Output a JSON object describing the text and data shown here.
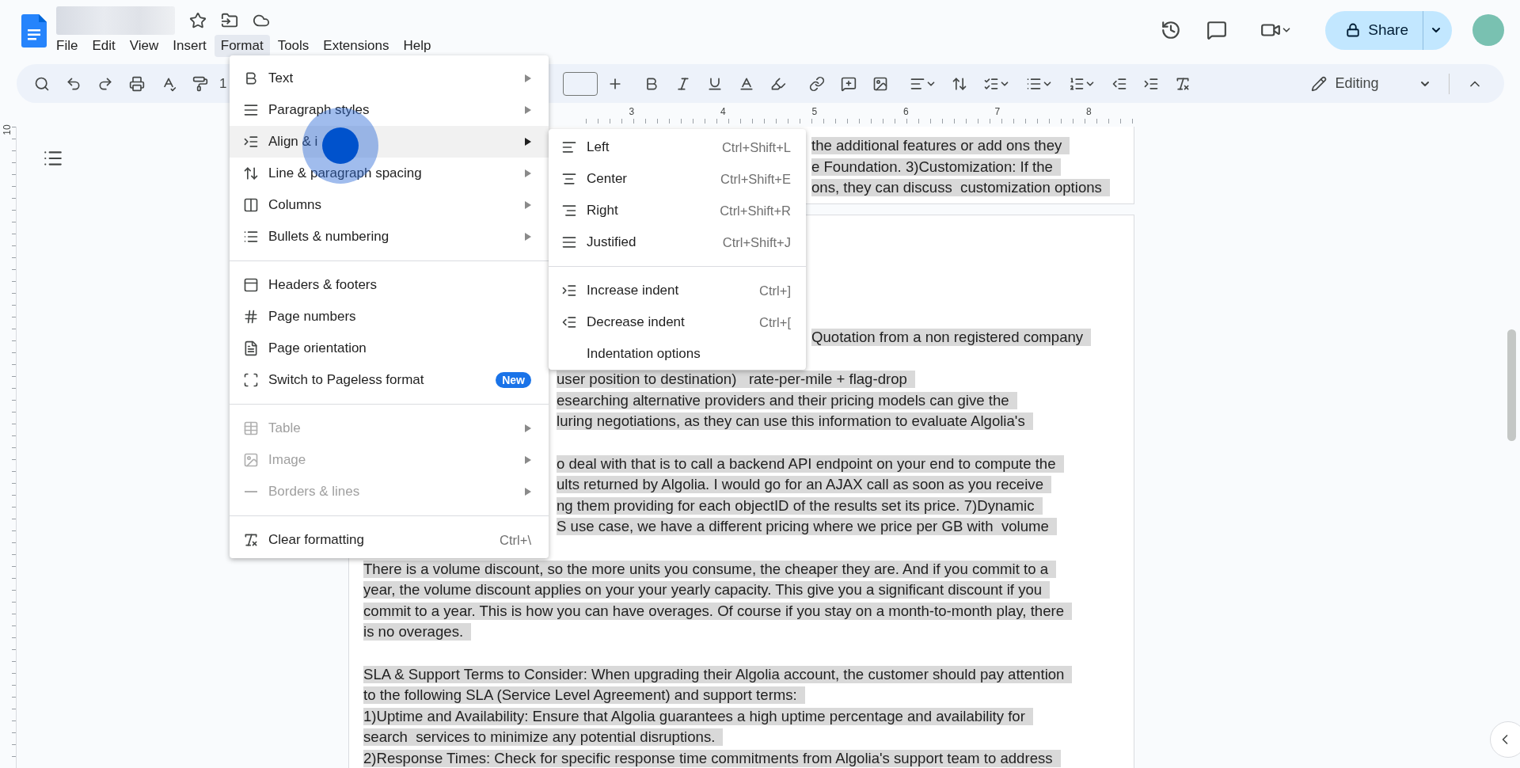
{
  "menubar": [
    {
      "label": "File",
      "selected": false
    },
    {
      "label": "Edit",
      "selected": false
    },
    {
      "label": "View",
      "selected": false
    },
    {
      "label": "Insert",
      "selected": false
    },
    {
      "label": "Format",
      "selected": true
    },
    {
      "label": "Tools",
      "selected": false
    },
    {
      "label": "Extensions",
      "selected": false
    },
    {
      "label": "Help",
      "selected": false
    }
  ],
  "share_button": {
    "label": "Share"
  },
  "toolbar": {
    "zoom": "1",
    "mode": "Editing"
  },
  "ruler": {
    "inch_labels": [
      "3",
      "4",
      "5",
      "6",
      "7",
      "8"
    ],
    "vertical_label": "10"
  },
  "format_menu": {
    "groups": [
      [
        {
          "label": "Text",
          "submenu": true,
          "disabled": false,
          "selected": false
        },
        {
          "label": "Paragraph styles",
          "submenu": true,
          "disabled": false,
          "selected": false
        },
        {
          "label": "Align & i",
          "submenu": true,
          "disabled": false,
          "selected": true
        },
        {
          "label": "Line & paragraph spacing",
          "submenu": true,
          "disabled": false,
          "selected": false
        },
        {
          "label": "Columns",
          "submenu": true,
          "disabled": false,
          "selected": false
        },
        {
          "label": "Bullets & numbering",
          "submenu": true,
          "disabled": false,
          "selected": false
        }
      ],
      [
        {
          "label": "Headers & footers",
          "submenu": false,
          "disabled": false,
          "selected": false
        },
        {
          "label": "Page numbers",
          "submenu": false,
          "disabled": false,
          "selected": false
        },
        {
          "label": "Page orientation",
          "submenu": false,
          "disabled": false,
          "selected": false
        },
        {
          "label": "Switch to Pageless format",
          "submenu": false,
          "disabled": false,
          "selected": false,
          "badge": "New"
        }
      ],
      [
        {
          "label": "Table",
          "submenu": true,
          "disabled": true,
          "selected": false
        },
        {
          "label": "Image",
          "submenu": true,
          "disabled": true,
          "selected": false
        },
        {
          "label": "Borders & lines",
          "submenu": true,
          "disabled": true,
          "selected": false
        }
      ],
      [
        {
          "label": "Clear formatting",
          "submenu": false,
          "disabled": false,
          "selected": false,
          "shortcut": "Ctrl+\\"
        }
      ]
    ]
  },
  "align_indent_submenu": {
    "groups": [
      [
        {
          "label": "Left",
          "shortcut": "Ctrl+Shift+L"
        },
        {
          "label": "Center",
          "shortcut": "Ctrl+Shift+E"
        },
        {
          "label": "Right",
          "shortcut": "Ctrl+Shift+R"
        },
        {
          "label": "Justified",
          "shortcut": "Ctrl+Shift+J"
        }
      ],
      [
        {
          "label": "Increase indent",
          "shortcut": "Ctrl+]"
        },
        {
          "label": "Decrease indent",
          "shortcut": "Ctrl+["
        },
        {
          "label": "Indentation options"
        }
      ]
    ]
  },
  "document": {
    "highlighted": true,
    "pages": [
      {
        "lines": [
          {
            "kind": "behind-submenu",
            "text": "the additional features or add ons they"
          },
          {
            "kind": "behind-submenu",
            "text": "e Foundation. 3)Customization: If the"
          },
          {
            "kind": "behind-submenu",
            "text": "ons, they can discuss  customization options"
          }
        ]
      },
      {
        "lines": [
          {
            "kind": "behind-submenu",
            "text": "Quotation from a non registered company"
          },
          {
            "kind": "blank"
          },
          {
            "kind": "behind-menu",
            "text": "user position to destination)   rate-per-mile + flag-drop"
          },
          {
            "kind": "behind-menu",
            "text": "esearching alternative providers and their pricing models can give the"
          },
          {
            "kind": "behind-menu",
            "text": "luring negotiations, as they can use this information to evaluate Algolia's"
          },
          {
            "kind": "blank"
          },
          {
            "kind": "behind-menu",
            "text": "o deal with that is to call a backend API endpoint on your end to compute the"
          },
          {
            "kind": "behind-menu",
            "text": "ults returned by Algolia. I would go for an AJAX call as soon as you receive"
          },
          {
            "kind": "behind-menu",
            "text": "ng them providing for each objectID of the results set its price. 7)Dynamic"
          },
          {
            "kind": "behind-menu",
            "text": "S use case, we have a different pricing where we price per GB with  volume"
          },
          {
            "kind": "blank"
          },
          {
            "kind": "full",
            "text": "There is a volume discount, so the more units you consume, the cheaper they are. And if you commit to a"
          },
          {
            "kind": "full",
            "text": "year, the volume discount applies on your your yearly capacity. This give you a significant discount if you"
          },
          {
            "kind": "full",
            "text": "commit to a year. This is how you can have overages. Of course if you stay on a month-to-month play, there"
          },
          {
            "kind": "full",
            "text": "is no overages."
          },
          {
            "kind": "blank"
          },
          {
            "kind": "full",
            "text": "SLA & Support Terms to Consider: When upgrading their Algolia account, the customer should pay attention"
          },
          {
            "kind": "full",
            "text": "to the following SLA (Service Level Agreement) and support terms:"
          },
          {
            "kind": "full",
            "text": "1)Uptime and Availability: Ensure that Algolia guarantees a high uptime percentage and availability for"
          },
          {
            "kind": "full",
            "text": "search  services to minimize any potential disruptions."
          },
          {
            "kind": "full",
            "text": "2)Response Times: Check for specific response time commitments from Algolia's support team to address"
          }
        ]
      }
    ]
  }
}
